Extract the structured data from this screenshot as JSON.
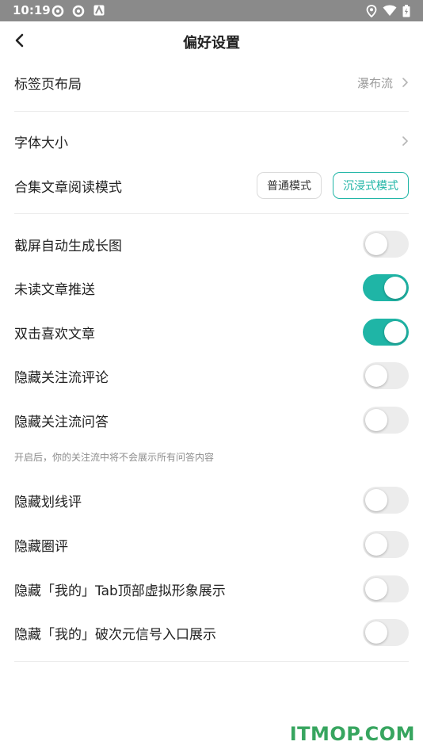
{
  "status_bar": {
    "time": "10:19"
  },
  "header": {
    "title": "偏好设置"
  },
  "settings": {
    "tab_layout": {
      "label": "标签页布局",
      "value": "瀑布流"
    },
    "font_size": {
      "label": "字体大小"
    },
    "reading_mode": {
      "label": "合集文章阅读模式",
      "options": [
        "普通模式",
        "沉浸式模式"
      ],
      "selected": "沉浸式模式"
    },
    "toggles": [
      {
        "label": "截屏自动生成长图",
        "on": false
      },
      {
        "label": "未读文章推送",
        "on": true
      },
      {
        "label": "双击喜欢文章",
        "on": true
      },
      {
        "label": "隐藏关注流评论",
        "on": false
      },
      {
        "label": "隐藏关注流问答",
        "on": false
      },
      {
        "label": "隐藏划线评",
        "on": false
      },
      {
        "label": "隐藏圈评",
        "on": false
      },
      {
        "label": "隐藏「我的」Tab顶部虚拟形象展示",
        "on": false
      },
      {
        "label": "隐藏「我的」破次元信号入口展示",
        "on": false
      }
    ],
    "qa_note": "开启后，你的关注流中将不会展示所有问答内容"
  },
  "colors": {
    "accent": "#1fb5a6",
    "toggle_off": "#ececec",
    "status_bar": "#8a8a8a"
  },
  "icons": [
    "back-arrow-icon",
    "chevron-right-icon"
  ],
  "watermark": "ITMOP.COM"
}
